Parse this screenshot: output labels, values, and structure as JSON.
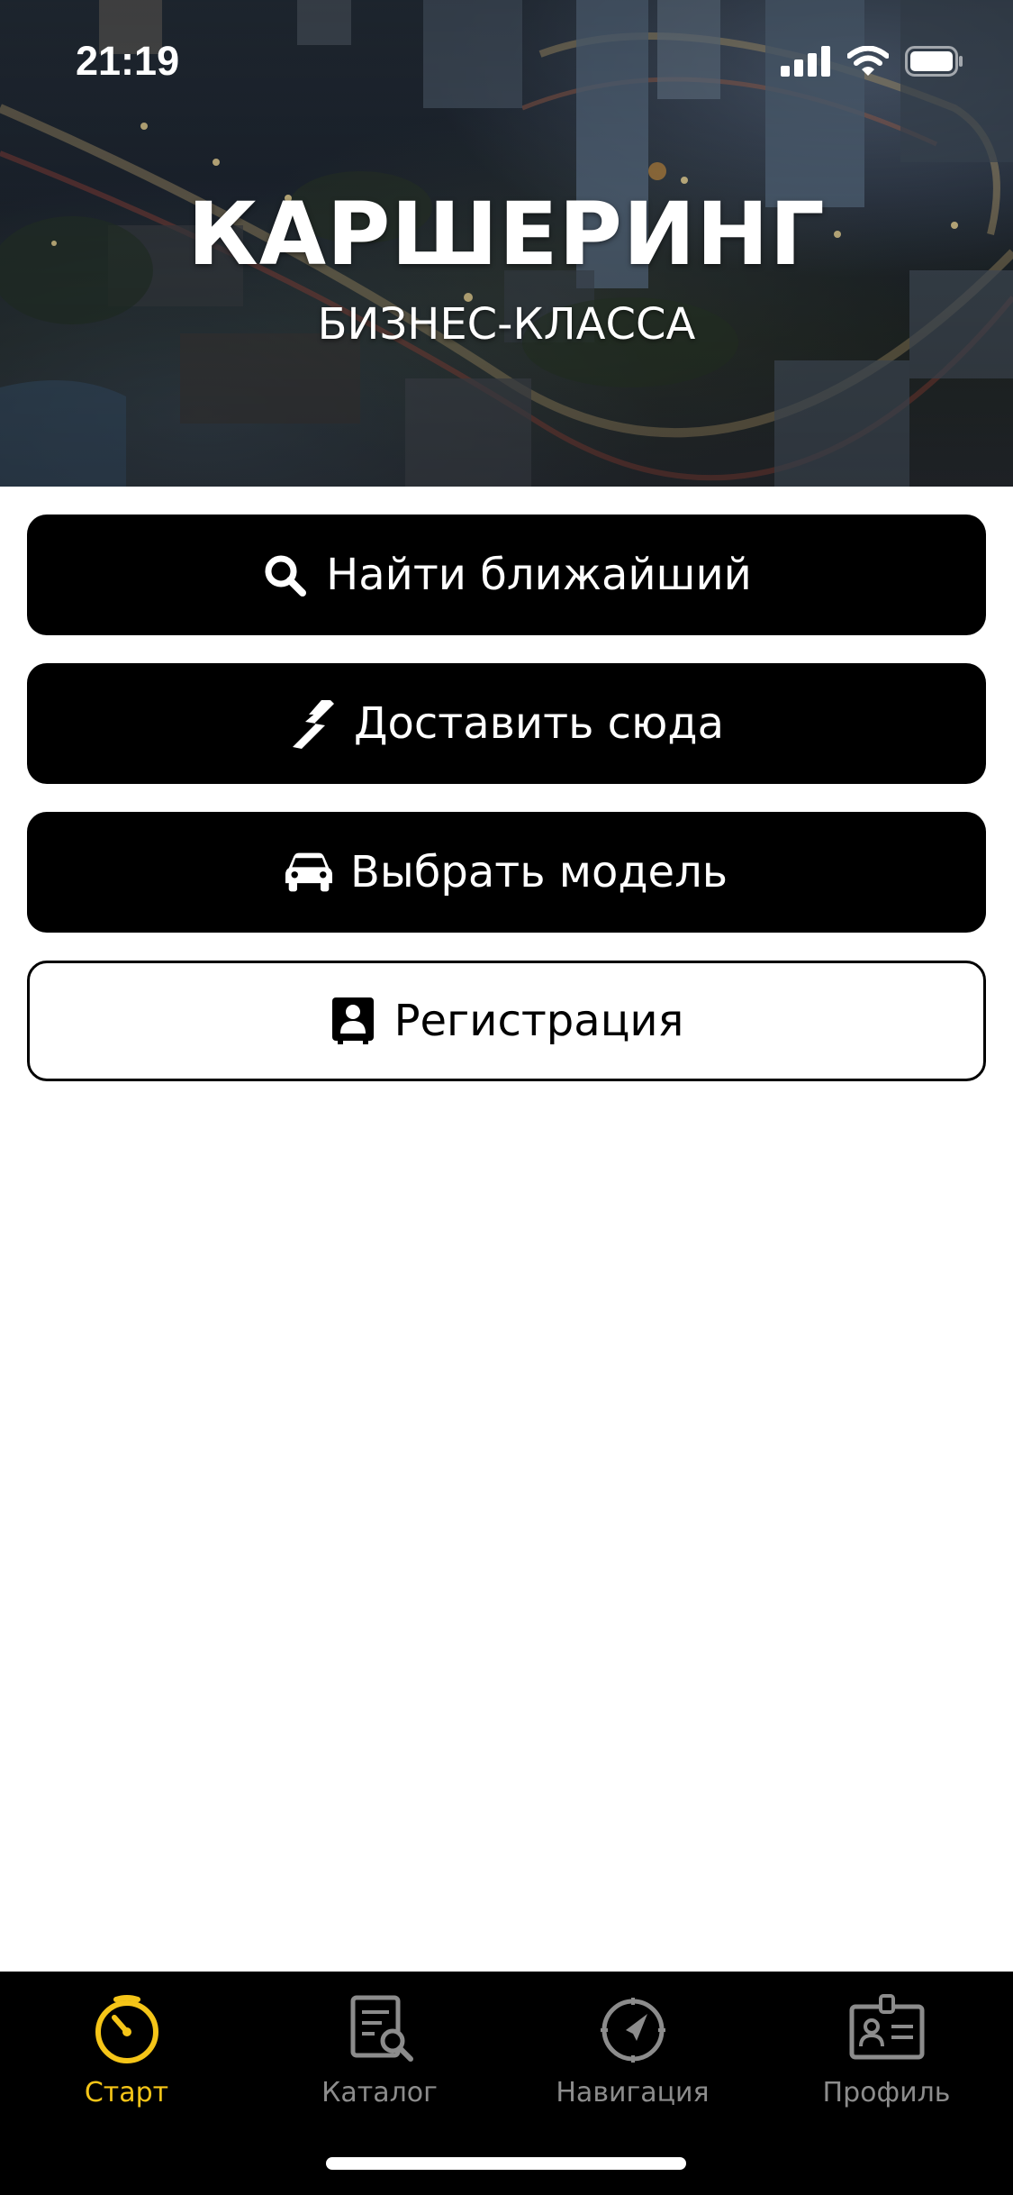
{
  "status_bar": {
    "time": "21:19",
    "icons": [
      "cellular-signal-icon",
      "wifi-icon",
      "battery-icon"
    ]
  },
  "hero": {
    "title": "КАРШЕРИНГ",
    "subtitle": "БИЗНЕС-КЛАССА"
  },
  "actions": [
    {
      "label": "Найти ближайший",
      "icon": "search-icon",
      "style": "filled"
    },
    {
      "label": "Доставить сюда",
      "icon": "lightning-icon",
      "style": "filled"
    },
    {
      "label": "Выбрать модель",
      "icon": "car-icon",
      "style": "filled"
    },
    {
      "label": "Регистрация",
      "icon": "id-badge-icon",
      "style": "outline"
    }
  ],
  "tabbar": {
    "active_index": 0,
    "tabs": [
      {
        "label": "Старт",
        "icon": "stopwatch-icon"
      },
      {
        "label": "Каталог",
        "icon": "catalog-search-icon"
      },
      {
        "label": "Навигация",
        "icon": "compass-icon"
      },
      {
        "label": "Профиль",
        "icon": "profile-card-icon"
      }
    ]
  },
  "colors": {
    "accent": "#f5c518",
    "tab_inactive": "#8c8c8c",
    "button_bg": "#000000",
    "button_text": "#ffffff"
  }
}
